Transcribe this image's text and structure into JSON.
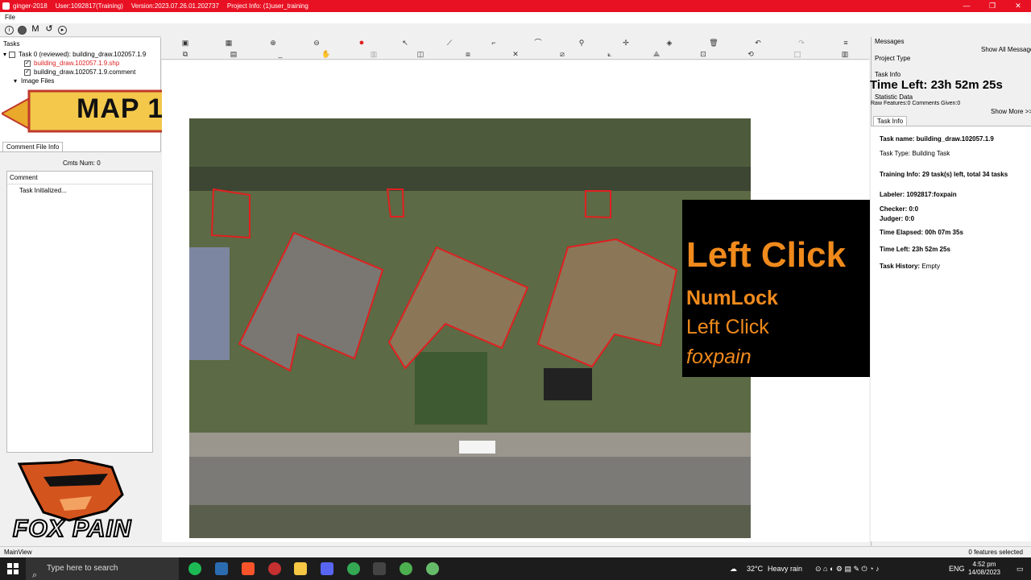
{
  "window": {
    "app_name": "ginger-2018",
    "user": "User:1092817(Training)",
    "version": "Version:2023.07.26.01.202737",
    "project_info": "Project Info: (1)user_training",
    "minimize": "—",
    "restore": "❐",
    "close": "✕"
  },
  "menu": {
    "file": "File"
  },
  "mini_toolbar": {
    "m_label": "M"
  },
  "tasks_panel": {
    "header": "Tasks",
    "task0": "Task 0 (reviewed): building_draw.102057.1.9",
    "shp_file": "building_draw.102057.1.9.shp",
    "comment_file": "building_draw.102057.1.9.comment",
    "image_files": "Image Files"
  },
  "banner": {
    "text": "MAP 1.9"
  },
  "comment_panel": {
    "tab": "Comment File Info",
    "cmts_num": "Cmts Num:  0",
    "comment_header": "Comment",
    "row": "Task Initialized..."
  },
  "logo": {
    "text": "FOX PAIN"
  },
  "key_overlay": {
    "main": "Left Click",
    "line1": "NumLock",
    "line2": "Left Click",
    "line3": "foxpain"
  },
  "right_panel": {
    "messages": "Messages",
    "show_all": "Show All Messages",
    "project_type": "Project Type",
    "task_info_header": "Task Info",
    "time_left_big": "Time Left: 23h 52m 25s",
    "statistic": "Statistic Data",
    "raw_features": "Raw Features:0 Comments Given:0",
    "show_more": "Show More >>",
    "task_info_tab": "Task Info",
    "task_name": "Task name: building_draw.102057.1.9",
    "task_type": "Task Type: Building Task",
    "training_info": "Training Info: 29 task(s) left, total 34 tasks",
    "labeler": "Labeler: 1092817:foxpain",
    "checker": "Checker: 0:0",
    "judger": "Judger: 0:0",
    "time_elapsed": "Time Elapsed: 00h 07m 35s",
    "time_left": "Time Left: 23h 52m 25s",
    "task_history": "Task History:",
    "task_history_value": "Empty"
  },
  "status": {
    "left": "MainView",
    "right": "0 features selected"
  },
  "taskbar": {
    "search_placeholder": "Type here to search",
    "temperature": "32°C",
    "weather": "Heavy rain",
    "language": "ENG",
    "time": "4:52 pm",
    "date": "14/08/2023"
  },
  "colors": {
    "title_red": "#e81123",
    "overlay_orange": "#f08a1c",
    "polygon_red": "#e02020",
    "banner_yellow": "#f3c84b"
  }
}
